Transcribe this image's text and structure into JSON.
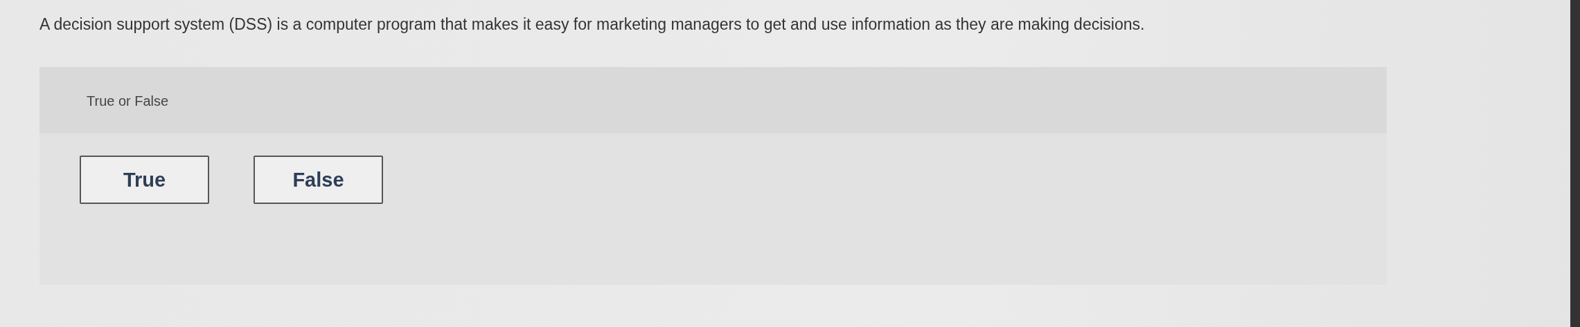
{
  "question": {
    "text": "A decision support system (DSS) is a computer program that makes it easy for marketing managers to get and use information as they are making decisions."
  },
  "answer_panel": {
    "prompt": "True or False",
    "options": [
      {
        "label": "True",
        "selected": false
      },
      {
        "label": "False",
        "selected": false
      }
    ]
  }
}
